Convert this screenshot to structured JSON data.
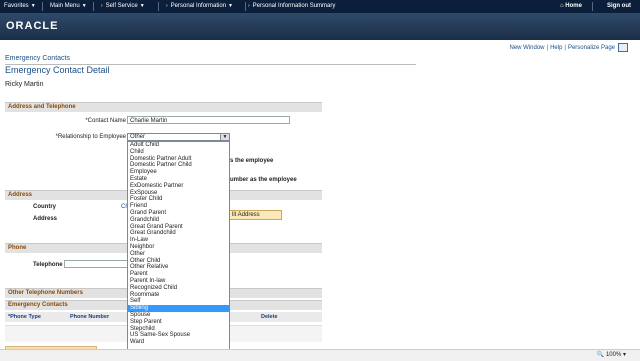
{
  "nav": {
    "favorites": "Favorites",
    "main_menu": "Main Menu",
    "self_service": "Self Service",
    "personal_info": "Personal Information",
    "summary": "Personal Information Summary",
    "home": "Home",
    "signout": "Sign out"
  },
  "brand": {
    "logo": "ORACLE"
  },
  "toplinks": {
    "new_window": "New Window",
    "help": "Help",
    "personalize": "Personalize Page"
  },
  "page": {
    "breadcrumb": "Emergency Contacts",
    "title": "Emergency Contact Detail",
    "employee": "Ricky Martin"
  },
  "sections": {
    "address_phone": "Address and Telephone",
    "address": "Address",
    "phone": "Phone",
    "other_phones": "Other Telephone Numbers",
    "emergency": "Emergency Contacts"
  },
  "form": {
    "contact_name_label": "*Contact Name",
    "contact_name_value": "Charlie Martin",
    "relationship_label": "*Relationship to Employee",
    "relationship_value": "Other",
    "same_address_text": "s the employee",
    "same_phone_text": "umber as the employee",
    "country_label": "Country",
    "country_value": "Ch",
    "address_label": "Address",
    "edit_address": "lit Address",
    "telephone_label": "Telephone"
  },
  "grid": {
    "col_phone_type": "*Phone Type",
    "col_phone_number": "Phone Number",
    "col_delete": "Delete"
  },
  "dropdown": {
    "options": [
      "Adult Child",
      "Child",
      "Domestic Partner Adult",
      "Domestic Partner Child",
      "Employee",
      "Estate",
      "ExDomestic Partner",
      "ExSpouse",
      "Foster Child",
      "Friend",
      "Grand Parent",
      "Grandchild",
      "Great Grand Parent",
      "Great Grandchild",
      "In-Law",
      "Neighbor",
      "Other",
      "Other Child",
      "Other Relative",
      "Parent",
      "Parent In-law",
      "Recognized Child",
      "Roommate",
      "Self",
      "Sibling",
      "Spouse",
      "Step Parent",
      "Stepchild",
      "US Same-Sex Spouse",
      "Ward"
    ],
    "selected_index": 24
  },
  "status": {
    "zoom": "100%"
  },
  "colors": {
    "nav_bg": "#0b1e3a",
    "banner": "#2f4a6a",
    "section_text": "#8a4a0a",
    "highlight": "#3399ff"
  }
}
